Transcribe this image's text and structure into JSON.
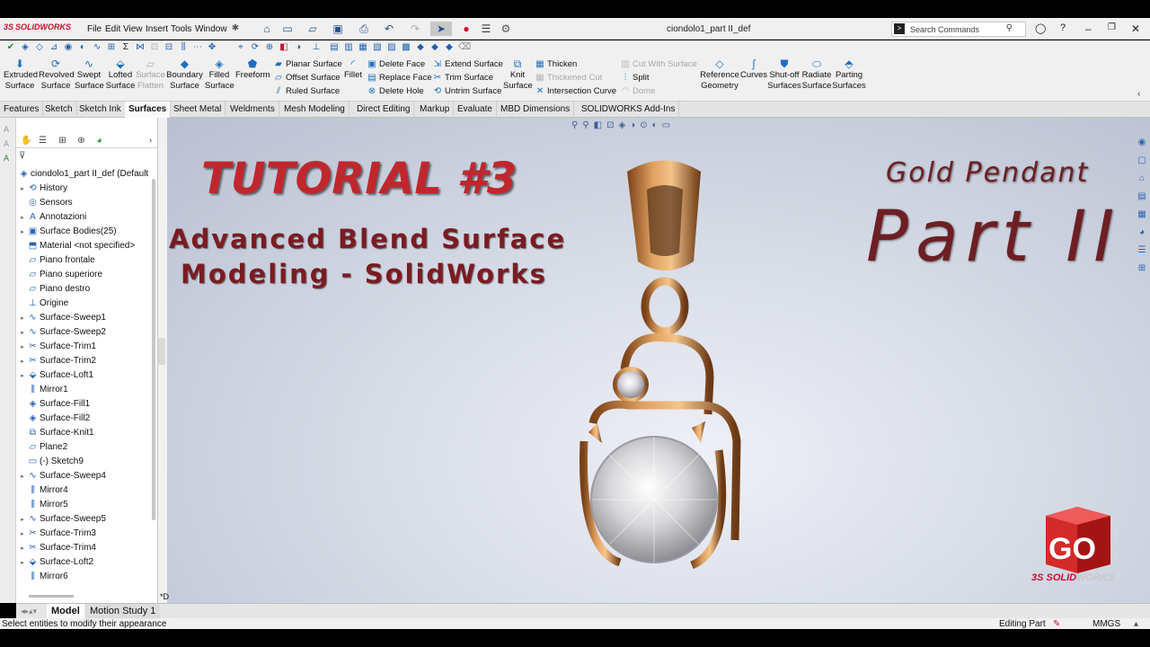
{
  "app": {
    "brand": "SOLIDWORKS",
    "doc_title": "ciondolo1_part II_def",
    "search_placeholder": "Search Commands",
    "menus": [
      "File",
      "Edit",
      "View",
      "Insert",
      "Tools",
      "Window"
    ]
  },
  "command_manager": {
    "big_tools": [
      {
        "label1": "Extruded",
        "label2": "Surface",
        "icon": "extruded-surface-icon"
      },
      {
        "label1": "Revolved",
        "label2": "Surface",
        "icon": "revolved-surface-icon"
      },
      {
        "label1": "Swept",
        "label2": "Surface",
        "icon": "swept-surface-icon"
      },
      {
        "label1": "Lofted",
        "label2": "Surface",
        "icon": "lofted-surface-icon"
      },
      {
        "label1": "Surface",
        "label2": "Flatten",
        "icon": "surface-flatten-icon",
        "disabled": true
      },
      {
        "label1": "Boundary",
        "label2": "Surface",
        "icon": "boundary-surface-icon"
      },
      {
        "label1": "Filled",
        "label2": "Surface",
        "icon": "filled-surface-icon"
      },
      {
        "label1": "Freeform",
        "label2": "",
        "icon": "freeform-icon"
      }
    ],
    "col1": [
      "Planar Surface",
      "Offset Surface",
      "Ruled Surface"
    ],
    "fillet": "Fillet",
    "col2": [
      "Delete Face",
      "Replace Face",
      "Delete Hole"
    ],
    "col3": [
      "Extend Surface",
      "Trim Surface",
      "Untrim Surface"
    ],
    "knit": {
      "label1": "Knit",
      "label2": "Surface"
    },
    "col4": [
      {
        "label": "Thicken",
        "disabled": false
      },
      {
        "label": "Thickened Cut",
        "disabled": true
      },
      {
        "label": "Intersection Curve",
        "disabled": false
      }
    ],
    "col5": [
      {
        "label": "Cut With Surface",
        "disabled": true
      },
      {
        "label": "Split",
        "disabled": false
      },
      {
        "label": "Dome",
        "disabled": true
      }
    ],
    "right_tools": [
      {
        "label1": "Reference",
        "label2": "Geometry"
      },
      {
        "label1": "Curves",
        "label2": ""
      },
      {
        "label1": "Shut-off",
        "label2": "Surfaces"
      },
      {
        "label1": "Radiate",
        "label2": "Surface"
      },
      {
        "label1": "Parting",
        "label2": "Surfaces"
      }
    ]
  },
  "tabs": [
    "Features",
    "Sketch",
    "Sketch Ink",
    "Surfaces",
    "Sheet Metal",
    "Weldments",
    "Mesh Modeling",
    "Direct Editing",
    "Markup",
    "Evaluate",
    "MBD Dimensions",
    "SOLIDWORKS Add-Ins"
  ],
  "active_tab": "Surfaces",
  "feature_tree": {
    "root": "ciondolo1_part II_def (Default",
    "items": [
      {
        "label": "History",
        "expandable": true,
        "icon": "history-icon"
      },
      {
        "label": "Sensors",
        "expandable": false,
        "icon": "sensors-icon"
      },
      {
        "label": "Annotazioni",
        "expandable": true,
        "icon": "annotations-icon"
      },
      {
        "label": "Surface Bodies(25)",
        "expandable": true,
        "icon": "surface-bodies-icon"
      },
      {
        "label": "Material <not specified>",
        "expandable": false,
        "icon": "material-icon"
      },
      {
        "label": "Piano frontale",
        "expandable": false,
        "icon": "plane-icon"
      },
      {
        "label": "Piano superiore",
        "expandable": false,
        "icon": "plane-icon"
      },
      {
        "label": "Piano destro",
        "expandable": false,
        "icon": "plane-icon"
      },
      {
        "label": "Origine",
        "expandable": false,
        "icon": "origin-icon"
      },
      {
        "label": "Surface-Sweep1",
        "expandable": true,
        "icon": "sweep-icon"
      },
      {
        "label": "Surface-Sweep2",
        "expandable": true,
        "icon": "sweep-icon"
      },
      {
        "label": "Surface-Trim1",
        "expandable": true,
        "icon": "trim-icon"
      },
      {
        "label": "Surface-Trim2",
        "expandable": true,
        "icon": "trim-icon"
      },
      {
        "label": "Surface-Loft1",
        "expandable": true,
        "icon": "loft-icon"
      },
      {
        "label": "Mirror1",
        "expandable": false,
        "icon": "mirror-icon"
      },
      {
        "label": "Surface-Fill1",
        "expandable": false,
        "icon": "fill-icon"
      },
      {
        "label": "Surface-Fill2",
        "expandable": false,
        "icon": "fill-icon"
      },
      {
        "label": "Surface-Knit1",
        "expandable": false,
        "icon": "knit-icon"
      },
      {
        "label": "Plane2",
        "expandable": false,
        "icon": "plane-icon"
      },
      {
        "label": "(-) Sketch9",
        "expandable": false,
        "icon": "sketch-icon"
      },
      {
        "label": "Surface-Sweep4",
        "expandable": true,
        "icon": "sweep-icon"
      },
      {
        "label": "Mirror4",
        "expandable": false,
        "icon": "mirror-icon"
      },
      {
        "label": "Mirror5",
        "expandable": false,
        "icon": "mirror-icon"
      },
      {
        "label": "Surface-Sweep5",
        "expandable": true,
        "icon": "sweep-icon"
      },
      {
        "label": "Surface-Trim3",
        "expandable": true,
        "icon": "trim-icon"
      },
      {
        "label": "Surface-Trim4",
        "expandable": true,
        "icon": "trim-icon"
      },
      {
        "label": "Surface-Loft2",
        "expandable": true,
        "icon": "loft-icon"
      },
      {
        "label": "Mirror6",
        "expandable": false,
        "icon": "mirror-icon"
      }
    ]
  },
  "viewport": {
    "title_main": "TUTORIAL #3",
    "subtitle_line1": "Advanced Blend Surface",
    "subtitle_line2": "Modeling - SolidWorks",
    "right_line1": "Gold Pendant",
    "right_line2": "Part II",
    "logo_text": "GO",
    "logo_brand_a": "3S SOLID",
    "logo_brand_b": "WORKS",
    "star_label": "*D"
  },
  "bottom_tabs": [
    "Model",
    "Motion Study 1"
  ],
  "active_bottom_tab": "Model",
  "status": {
    "message": "Select entities to modify their appearance",
    "mode": "Editing Part",
    "units": "MMGS"
  },
  "colors": {
    "accent_red": "#c0272d",
    "gold": "#c98a4a",
    "brand_red": "#c8102e"
  }
}
